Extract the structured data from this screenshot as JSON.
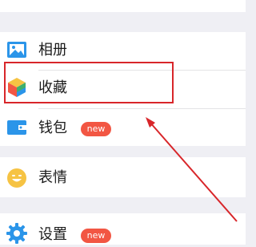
{
  "menu": {
    "items": [
      {
        "label": "相册",
        "icon": "photo-album-icon"
      },
      {
        "label": "收藏",
        "icon": "favorites-cube-icon"
      },
      {
        "label": "钱包",
        "icon": "wallet-icon",
        "badge": "new"
      },
      {
        "label": "表情",
        "icon": "emoji-icon"
      },
      {
        "label": "设置",
        "icon": "gear-icon",
        "badge": "new"
      }
    ]
  },
  "colors": {
    "accent": "#2b95e9",
    "badge": "#f25643",
    "annotation": "#d8262a",
    "emoji": "#f6c343",
    "background": "#efeff4"
  }
}
